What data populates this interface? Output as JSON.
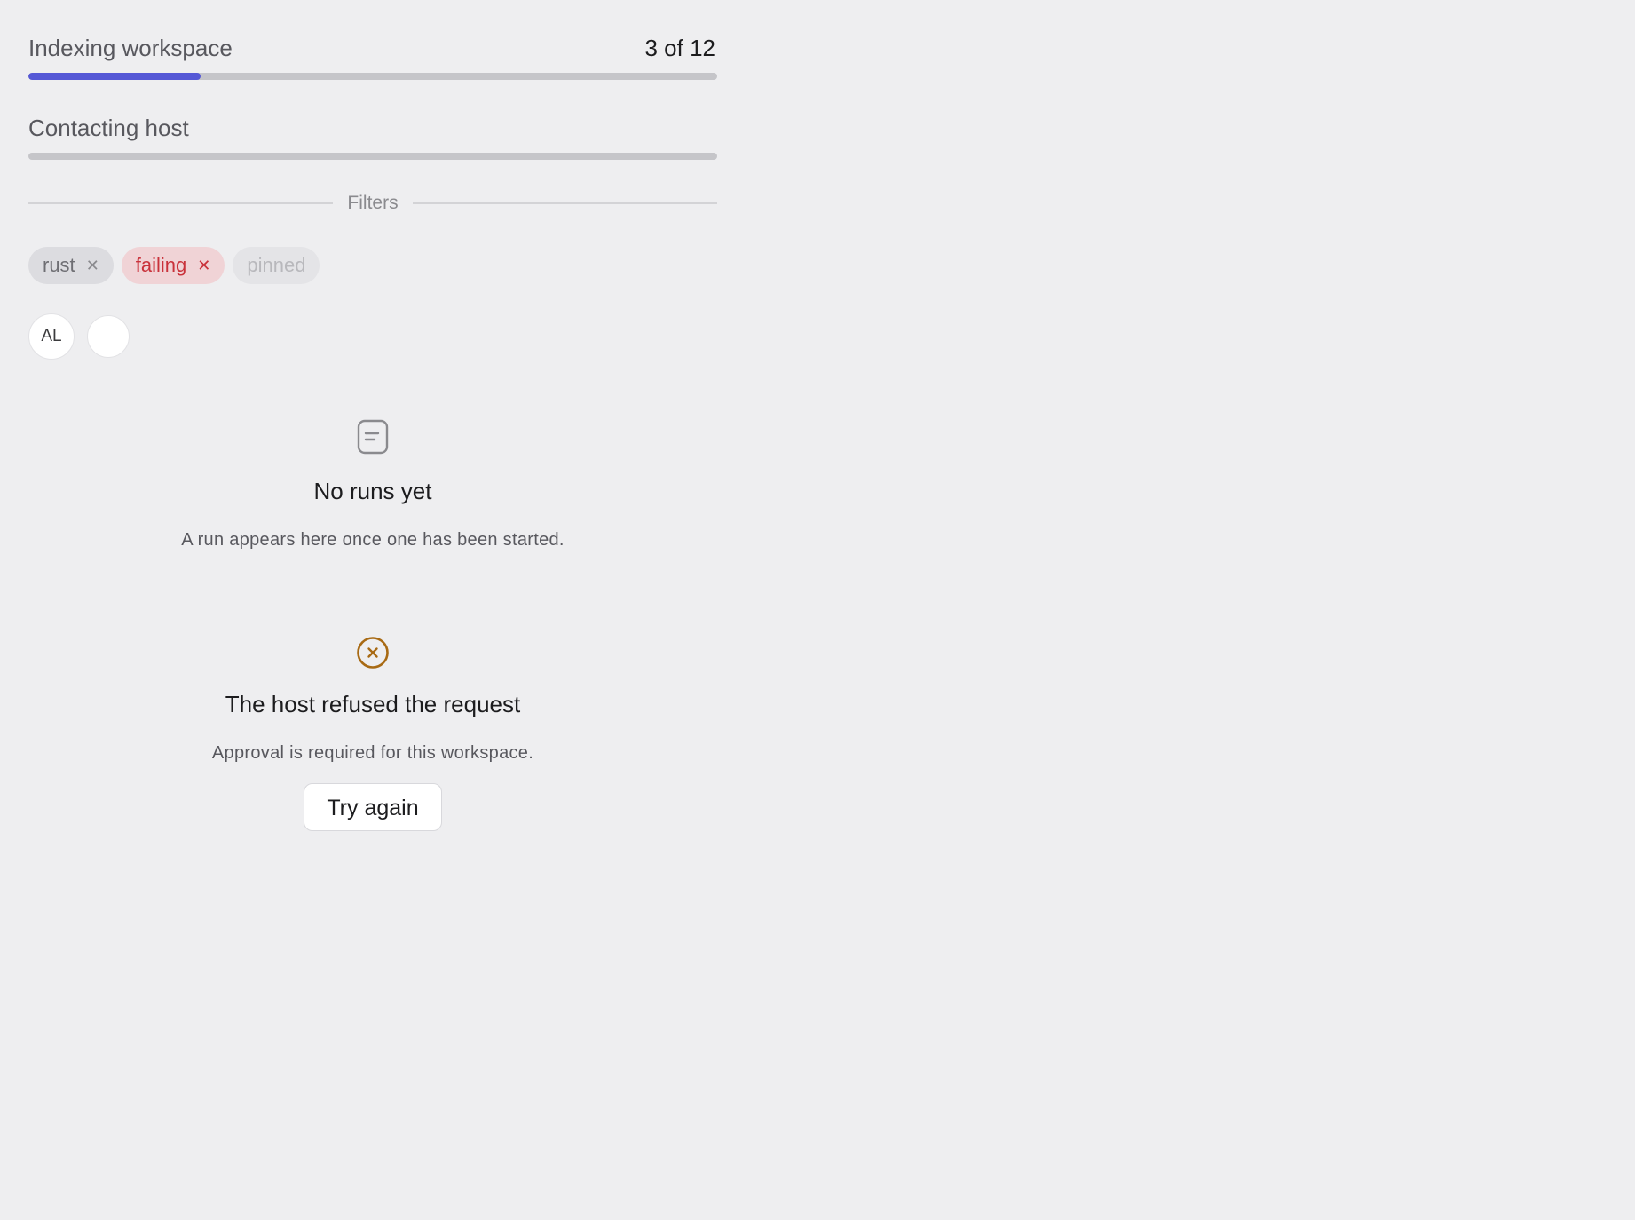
{
  "progress": [
    {
      "label": "Indexing workspace",
      "count": "3 of 12",
      "value": 0.25,
      "fill_color": "#5558d6"
    },
    {
      "label": "Contacting host",
      "count": "",
      "value": 0,
      "fill_color": "#5558d6"
    }
  ],
  "filters": {
    "heading": "Filters",
    "chips": [
      {
        "label": "rust",
        "variant": "neutral",
        "removable": true,
        "close_icon": "close-icon"
      },
      {
        "label": "failing",
        "variant": "danger",
        "color": "#c9323b",
        "removable": true,
        "close_icon": "close-icon"
      },
      {
        "label": "pinned",
        "variant": "disabled",
        "removable": false
      }
    ]
  },
  "avatars": [
    {
      "initials": "AL"
    },
    {
      "initials": ""
    }
  ],
  "empty_state": {
    "icon": "document-icon",
    "title": "No runs yet",
    "description": "A run appears here once one has been started."
  },
  "error_state": {
    "icon": "error-circle-x-icon",
    "icon_color": "#a86a14",
    "title": "The host refused the request",
    "description": "Approval is required for this workspace.",
    "retry_label": "Try again"
  }
}
